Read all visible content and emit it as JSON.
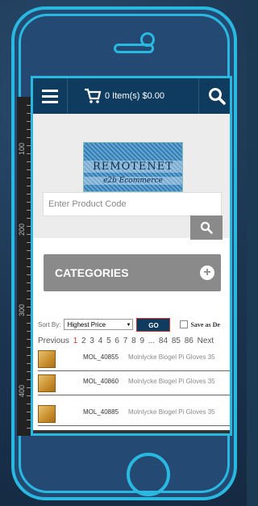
{
  "header": {
    "cart_label": "0 Item(s) $0.00"
  },
  "logo": {
    "title": "REMOTENET",
    "subtitle": "e2b Ecommerce"
  },
  "search": {
    "placeholder": "Enter Product Code"
  },
  "categories": {
    "label": "CATEGORIES"
  },
  "sort": {
    "label": "Sort By:",
    "selected": "Highest Price",
    "go_label": "GO",
    "save_label": "Save as De"
  },
  "pager": {
    "previous": "Previous",
    "current": "1",
    "pages": [
      "2",
      "3",
      "4",
      "5",
      "6",
      "7",
      "8",
      "9"
    ],
    "ellipsis": "...",
    "last_pages": [
      "84",
      "85",
      "86"
    ],
    "next": "Next"
  },
  "ruler": {
    "labels": [
      "100",
      "200",
      "300",
      "400"
    ]
  },
  "products": [
    {
      "sku": "MOL_40855",
      "desc": "Molnlycke Biogel Pi Gloves 35"
    },
    {
      "sku": "MOL_40860",
      "desc": "Molnlycke Biogel Pi Gloves 35"
    },
    {
      "sku": "MOL_40885",
      "desc": "Molnlycke Biogel Pi Gloves 35"
    }
  ],
  "colors": {
    "nav": "#0f3b5f",
    "accent": "#29b9e0",
    "gray_button": "#8a8a8a",
    "current_page": "#cc3333"
  }
}
